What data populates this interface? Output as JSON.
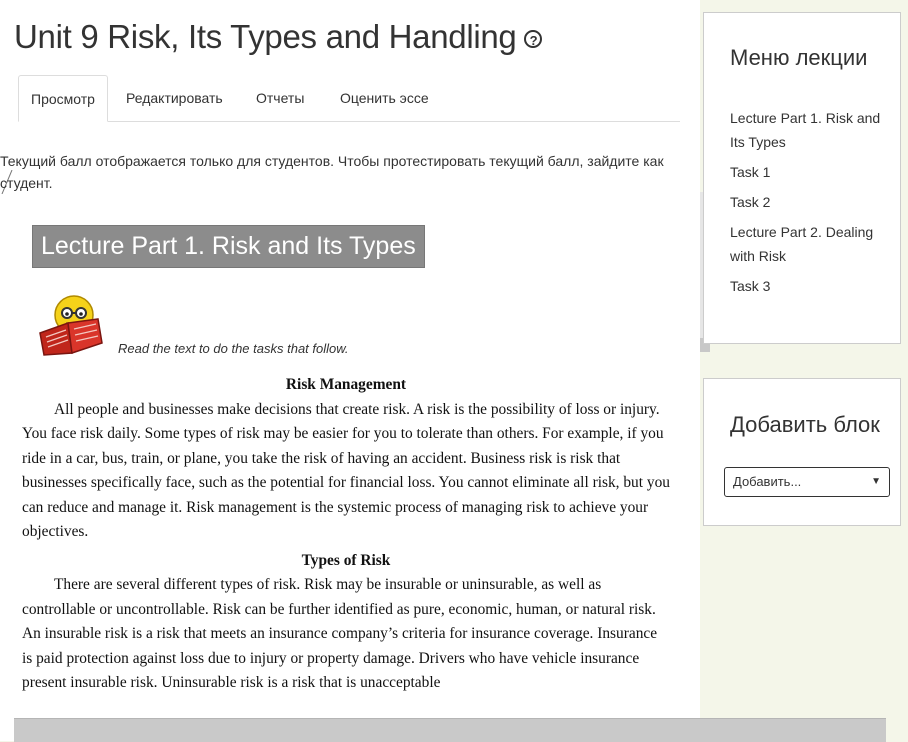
{
  "page": {
    "title": "Unit 9 Risk, Its Types and Handling",
    "help_icon": "?"
  },
  "tabs": [
    {
      "label": "Просмотр",
      "active": true
    },
    {
      "label": "Редактировать",
      "active": false
    },
    {
      "label": "Отчеты",
      "active": false
    },
    {
      "label": "Оценить эссе",
      "active": false
    }
  ],
  "notice": "Текущий балл отображается только для студентов. Чтобы протестировать текущий балл, зайдите как студент.",
  "lecture": {
    "heading": "Lecture Part 1. Risk and Its Types",
    "reader_icon": "reading-smiley-icon",
    "instruction": "Read the text to do the tasks that follow.",
    "section1_title": "Risk Management",
    "section1_text": "All people and businesses make decisions that create risk. A risk is the possibility of loss or injury. You face risk daily. Some types of risk may be easier for you to tolerate than others. For example, if you ride in a car, bus, train, or plane, you take the risk of having an accident. Business risk is risk that businesses specifically face, such as the potential for financial loss. You cannot eliminate all risk, but you can reduce and manage it. Risk management is the systemic process of managing risk to achieve your objectives.",
    "section2_title": "Types of Risk",
    "section2_text": "There are several different types of risk. Risk may be insurable or uninsurable, as well as controllable or uncontrollable. Risk can be further identified as pure, economic, human, or natural risk. An insurable risk is a risk that meets an insurance company’s criteria for insurance coverage. Insurance is paid protection against loss due to injury or property damage. Drivers who have vehicle insurance present insurable risk. Uninsurable risk is a risk that is unacceptable"
  },
  "sidebar": {
    "menu_title": "Меню лекции",
    "menu_items": [
      "Lecture Part 1. Risk and Its Types",
      "Task 1",
      "Task 2",
      "Lecture Part 2. Dealing with Risk",
      "Task 3"
    ],
    "add_block_title": "Добавить блок",
    "add_select_value": "Добавить...",
    "add_select_arrow": "▼"
  },
  "colors": {
    "background": "#f4f6e9",
    "heading_bg": "#8c8c8c",
    "text": "#333333"
  }
}
